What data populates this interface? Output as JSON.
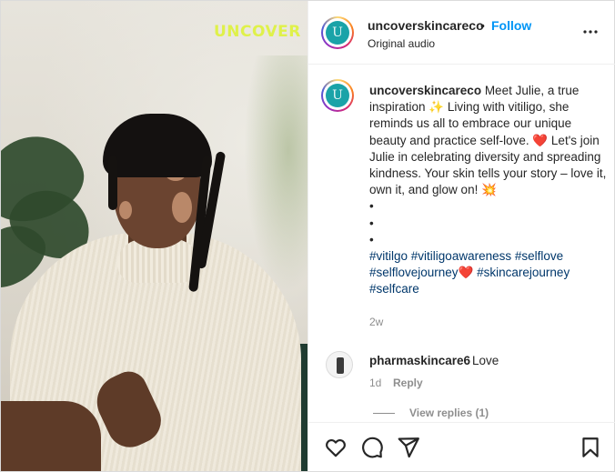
{
  "media": {
    "overlay_text": "UNCOVER"
  },
  "post_header": {
    "username": "uncoverskincareco",
    "separator": "•",
    "follow_label": "Follow",
    "audio_label": "Original audio",
    "more_icon": "more-horizontal-icon",
    "avatar_letter": "U"
  },
  "caption": {
    "username": "uncoverskincareco",
    "text_1": " Meet Julie, a true inspiration ",
    "emoji_1": "✨",
    "text_2": " Living with vitiligo, she reminds us all to embrace our unique beauty and practice self-love. ",
    "emoji_2": "❤️",
    "text_3": " Let's join Julie in celebrating diversity and spreading kindness. Your skin tells your story – love it, own it, and glow on! ",
    "emoji_3": "💥",
    "bullets": [
      "•",
      "•",
      "•"
    ],
    "hashtags": [
      "#vitilgo",
      "#vitiligoawareness",
      "#selflove",
      "#selflovejourney",
      "#skincarejourney",
      "#selfcare"
    ],
    "heart": "❤️",
    "timestamp": "2w"
  },
  "comments": [
    {
      "username": "pharmaskincare6",
      "text": "Love",
      "age": "1d",
      "reply_label": "Reply"
    }
  ],
  "view_replies_label": "View replies (1)",
  "actions": {
    "like_icon": "heart-icon",
    "comment_icon": "comment-icon",
    "share_icon": "send-icon",
    "save_icon": "bookmark-icon"
  },
  "colors": {
    "accent": "#0095f6",
    "hashtag": "#00376b",
    "muted": "#8e8e8e",
    "overlay": "#dff14a",
    "brand_teal": "#1aa3a8"
  }
}
